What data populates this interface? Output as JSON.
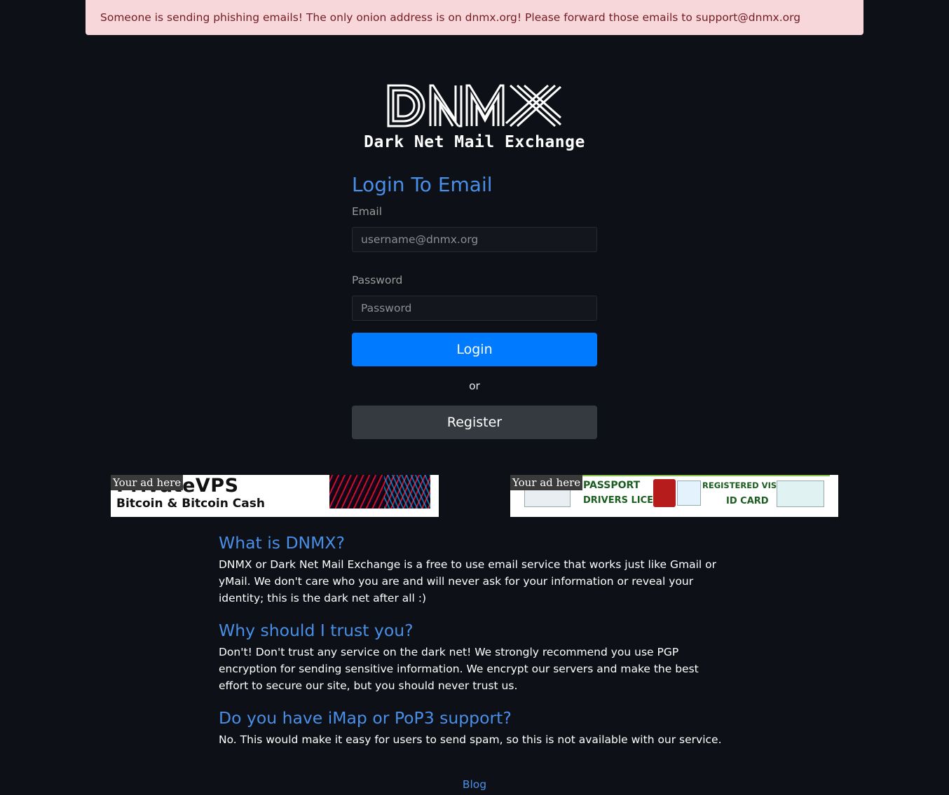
{
  "alert": {
    "text": "Someone is sending phishing emails! The only onion address is on dnmx.org! Please forward those emails to support@dnmx.org"
  },
  "logo": {
    "title": "DNMX",
    "subtitle": "Dark Net Mail Exchange"
  },
  "login": {
    "heading": "Login To Email",
    "email_label": "Email",
    "email_placeholder": "username@dnmx.org",
    "password_label": "Password",
    "password_placeholder": "Password",
    "login_button": "Login",
    "or_text": "or",
    "register_button": "Register"
  },
  "ads": {
    "left": {
      "tag": "Your ad here",
      "title": "PrivateVPS",
      "subtitle": "Bitcoin & Bitcoin Cash"
    },
    "right": {
      "tag": "Your ad here",
      "passport": "PASSPORT",
      "drivers": "DRIVERS LICENCE",
      "visa": "REGISTERED VISA",
      "idcard": "ID CARD"
    }
  },
  "faq": [
    {
      "question": "What is DNMX?",
      "answer": "DNMX or Dark Net Mail Exchange is a free to use email service that works just like Gmail or yMail. We don't care who you are and will never ask for your information or reveal your identity; this is the dark net after all :)"
    },
    {
      "question": "Why should I trust you?",
      "answer": "Don't! Don't trust any service on the dark net! We strongly recommend you use PGP encryption for sending sensitive information. We encrypt our servers and make the best effort to secure our site, but you should never trust us."
    },
    {
      "question": "Do you have iMap or PoP3 support?",
      "answer": "No. This would make it easy for users to send spam, so this is not available with our service."
    }
  ],
  "footer": {
    "blog_link": "Blog"
  },
  "colors": {
    "background": "#0d1117",
    "accent": "#4a8fe7",
    "primary_button": "#007bff",
    "secondary_button": "#343a40",
    "alert_bg": "#f8d7da",
    "alert_text": "#721c24"
  }
}
